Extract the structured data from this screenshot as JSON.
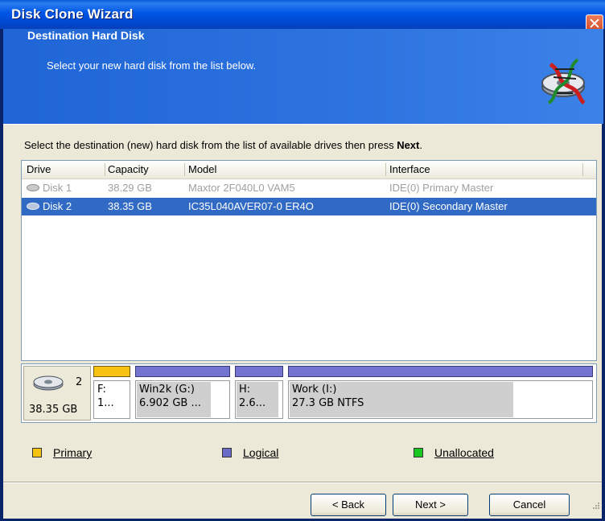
{
  "window": {
    "title": "Disk Clone Wizard"
  },
  "header": {
    "title": "Destination Hard Disk",
    "subtitle": "Select your new hard disk from the list below."
  },
  "instruction": {
    "text": "Select the destination (new) hard disk from the list of available drives then press ",
    "bold": "Next",
    "end": "."
  },
  "list": {
    "columns": [
      "Drive",
      "Capacity",
      "Model",
      "Interface"
    ],
    "rows": [
      {
        "drive": "Disk 1",
        "capacity": "38.29 GB",
        "model": "Maxtor 2F040L0 VAM5",
        "interface": "IDE(0) Primary Master",
        "state": "disabled"
      },
      {
        "drive": "Disk 2",
        "capacity": "38.35 GB",
        "model": "IC35L040AVER07-0 ER4O",
        "interface": "IDE(0) Secondary Master",
        "state": "selected"
      }
    ]
  },
  "diskmap": {
    "disk_number": "2",
    "disk_capacity": "38.35 GB",
    "partitions": [
      {
        "type": "primary",
        "label": "F:",
        "info": "1..."
      },
      {
        "type": "logical",
        "label": "Win2k (G:)",
        "info": "6.902 GB  ..."
      },
      {
        "type": "logical",
        "label": "H:",
        "info": "2.6..."
      },
      {
        "type": "logical",
        "label": "Work (I:)",
        "info": "27.3 GB  NTFS"
      }
    ]
  },
  "legend": {
    "primary": "Primary",
    "logical": "Logical",
    "unallocated": "Unallocated"
  },
  "colors": {
    "primary": "#f6c312",
    "logical": "#6a6ac8",
    "unallocated": "#19c81e",
    "selection": "#316ac5"
  },
  "buttons": {
    "back": "< Back",
    "next": "Next >",
    "cancel": "Cancel"
  }
}
